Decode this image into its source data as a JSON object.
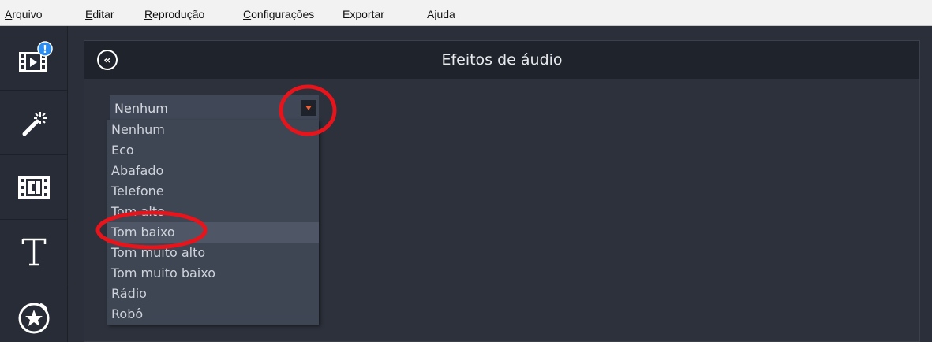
{
  "menubar": {
    "items": [
      {
        "first": "A",
        "rest": "rquivo"
      },
      {
        "first": "E",
        "rest": "ditar"
      },
      {
        "first": "R",
        "rest": "eprodução"
      },
      {
        "first": "C",
        "rest": "onfigurações"
      },
      {
        "first": "",
        "rest": "Exportar"
      },
      {
        "first": "",
        "rest": "Ajuda"
      }
    ]
  },
  "sidebar": {
    "items": [
      {
        "icon": "film-import-icon",
        "badge": "!"
      },
      {
        "icon": "magic-wand-icon"
      },
      {
        "icon": "transitions-icon"
      },
      {
        "icon": "text-icon"
      },
      {
        "icon": "sticker-star-icon"
      }
    ]
  },
  "panel": {
    "title": "Efeitos de áudio",
    "back_icon": "double-chevron-left-icon"
  },
  "effect_select": {
    "selected": "Nenhum",
    "options": [
      "Nenhum",
      "Eco",
      "Abafado",
      "Telefone",
      "Tom alto",
      "Tom baixo",
      "Tom muito alto",
      "Tom muito baixo",
      "Rádio",
      "Robô"
    ],
    "hovered": "Tom baixo"
  },
  "colors": {
    "accent_arrow": "#e8643c",
    "annotation": "#e8141c",
    "badge": "#2d8cf0"
  }
}
